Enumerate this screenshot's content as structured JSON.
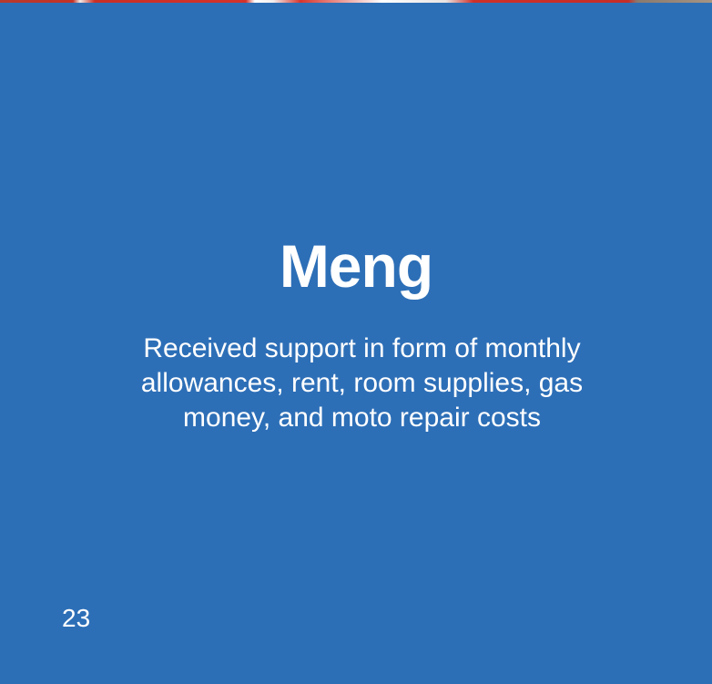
{
  "slide": {
    "title": "Meng",
    "description": "Received support in form of monthly allowances, rent, room supplies, gas money, and moto repair costs",
    "page_number": "23"
  },
  "colors": {
    "background": "#2d6fb7",
    "text": "#ffffff"
  }
}
